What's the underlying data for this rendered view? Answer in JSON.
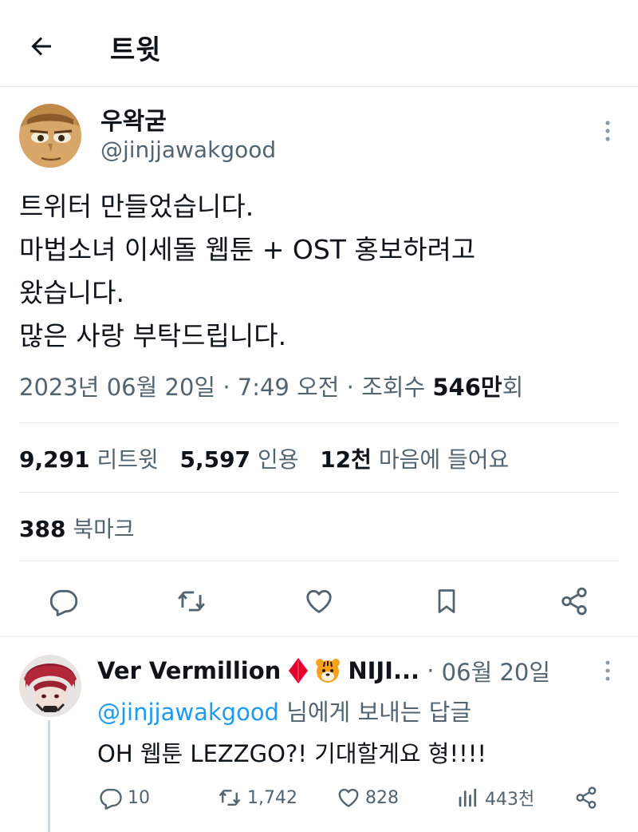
{
  "header": {
    "title": "트윗"
  },
  "tweet": {
    "author_name": "우왁굳",
    "author_handle": "@jinjjawakgood",
    "body_lines": [
      "트위터 만들었습니다.",
      "마법소녀 이세돌 웹툰 + OST 홍보하려고",
      "왔습니다.",
      "많은 사랑 부탁드립니다."
    ],
    "date": "2023년 06월 20일",
    "time": "7:49 오전",
    "views_label": "조회수",
    "views_value": "546만",
    "views_suffix": "회",
    "retweets_count": "9,291",
    "retweets_label": "리트윗",
    "quotes_count": "5,597",
    "quotes_label": "인용",
    "likes_count": "12천",
    "likes_label": "마음에 들어요",
    "bookmarks_count": "388",
    "bookmarks_label": "북마크"
  },
  "reply": {
    "author_name": "Ver Vermillion",
    "author_name_truncated": "NIJI...",
    "date": "06월 20일",
    "reply_to_handle": "@jinjjawakgood",
    "reply_to_suffix": "님에게 보내는 답글",
    "text": "OH 웹툰 LEZZGO?! 기대할게요 형!!!!",
    "replies": "10",
    "retweets": "1,742",
    "likes": "828",
    "views": "443천"
  },
  "colors": {
    "text": "#0f1419",
    "secondary": "#536471",
    "link": "#1d9bf0",
    "divider": "#e6e9ec"
  },
  "icons": {
    "back": "arrow-left-icon",
    "more": "more-vertical-icon",
    "reply": "comment-icon",
    "retweet": "retweet-icon",
    "like": "heart-icon",
    "bookmark": "bookmark-icon",
    "share": "share-icon",
    "views": "bar-chart-icon"
  }
}
